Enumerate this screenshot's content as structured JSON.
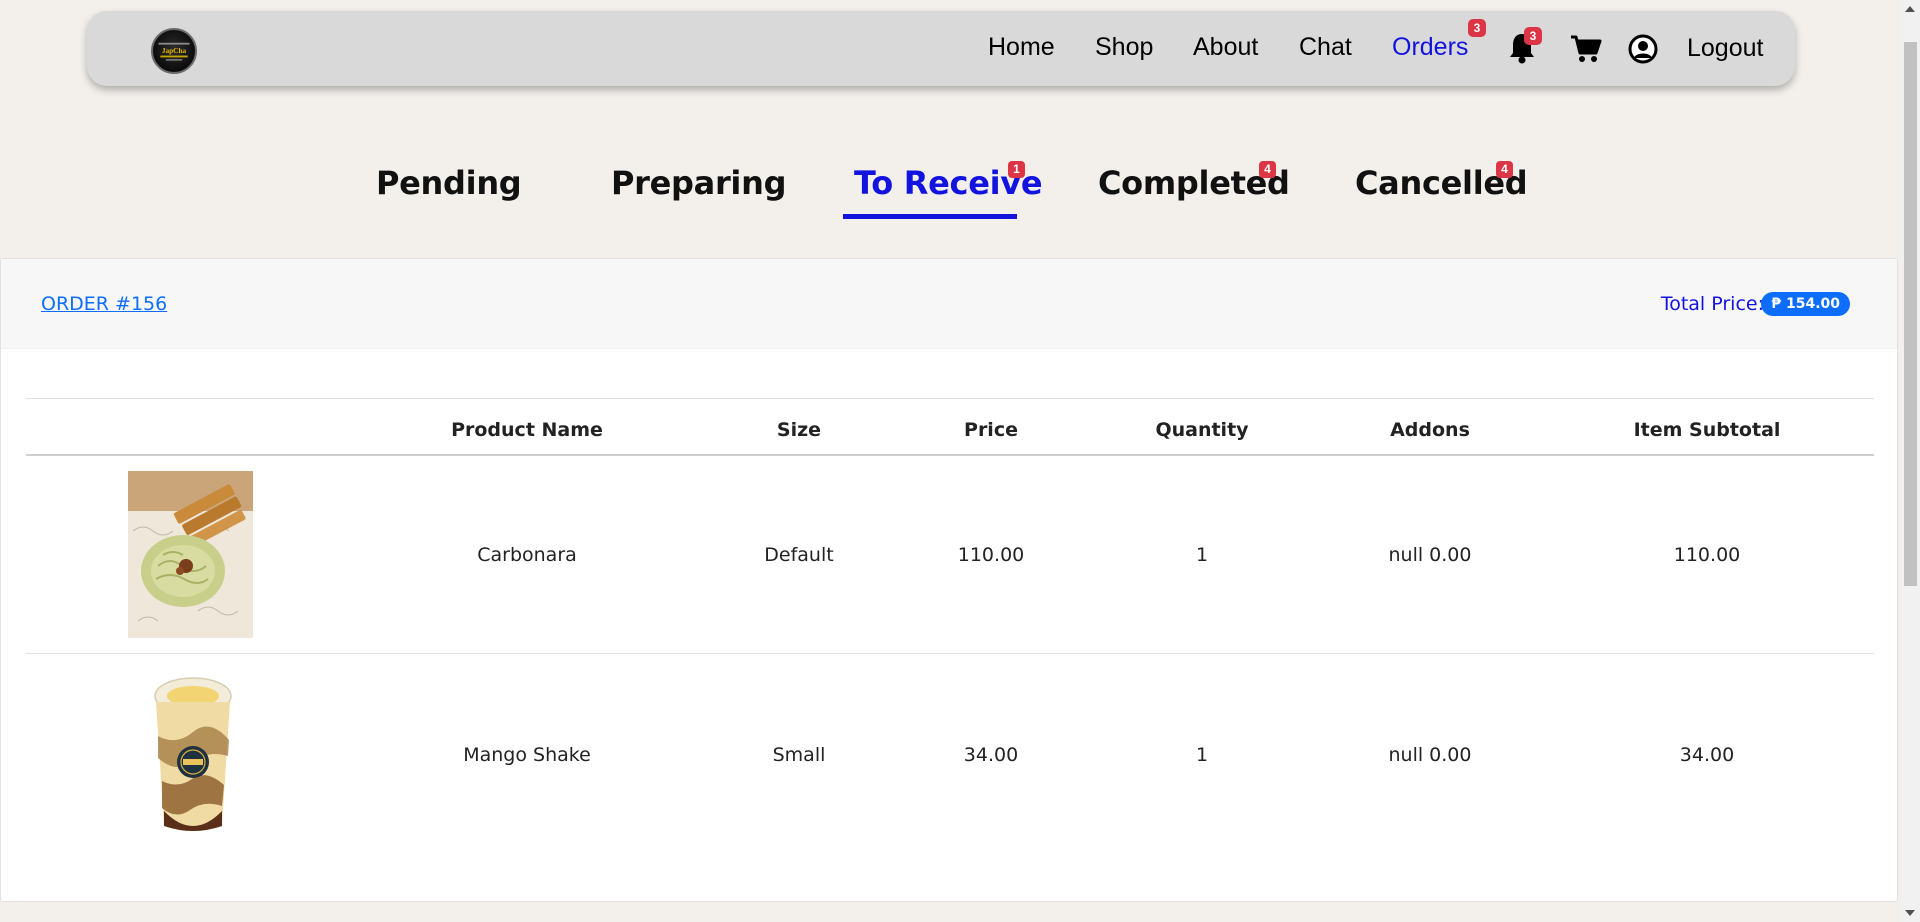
{
  "navbar": {
    "logo_text": "JapCha",
    "links": {
      "home": "Home",
      "shop": "Shop",
      "about": "About",
      "chat": "Chat",
      "orders": "Orders",
      "logout": "Logout"
    },
    "orders_badge": "3",
    "notifications_badge": "3",
    "icons": [
      "bell-icon",
      "cart-icon",
      "user-circle-icon"
    ],
    "active_color": "#1313e0"
  },
  "tabs": [
    {
      "label": "Pending",
      "badge": ""
    },
    {
      "label": "Preparing",
      "badge": ""
    },
    {
      "label": "To Receive",
      "badge": "1",
      "active": true
    },
    {
      "label": "Completed",
      "badge": "4"
    },
    {
      "label": "Cancelled",
      "badge": "4"
    }
  ],
  "order": {
    "title": "ORDER #156",
    "total_label": "Total Price:",
    "total_value": "₱ 154.00"
  },
  "table": {
    "headers": [
      "Product Name",
      "Size",
      "Price",
      "Quantity",
      "Addons",
      "Item Subtotal"
    ],
    "rows": [
      {
        "image": "carbonara-photo",
        "name": "Carbonara",
        "size": "Default",
        "price": "110.00",
        "quantity": "1",
        "addons": "null 0.00",
        "subtotal": "110.00"
      },
      {
        "image": "mango-shake-photo",
        "name": "Mango Shake",
        "size": "Small",
        "price": "34.00",
        "quantity": "1",
        "addons": "null 0.00",
        "subtotal": "34.00"
      }
    ]
  },
  "colors": {
    "badge_red": "#dc3545",
    "link_blue": "#0d6efd",
    "page_bg": "#f3f0ec",
    "navbar_bg": "#d9d9d9"
  }
}
